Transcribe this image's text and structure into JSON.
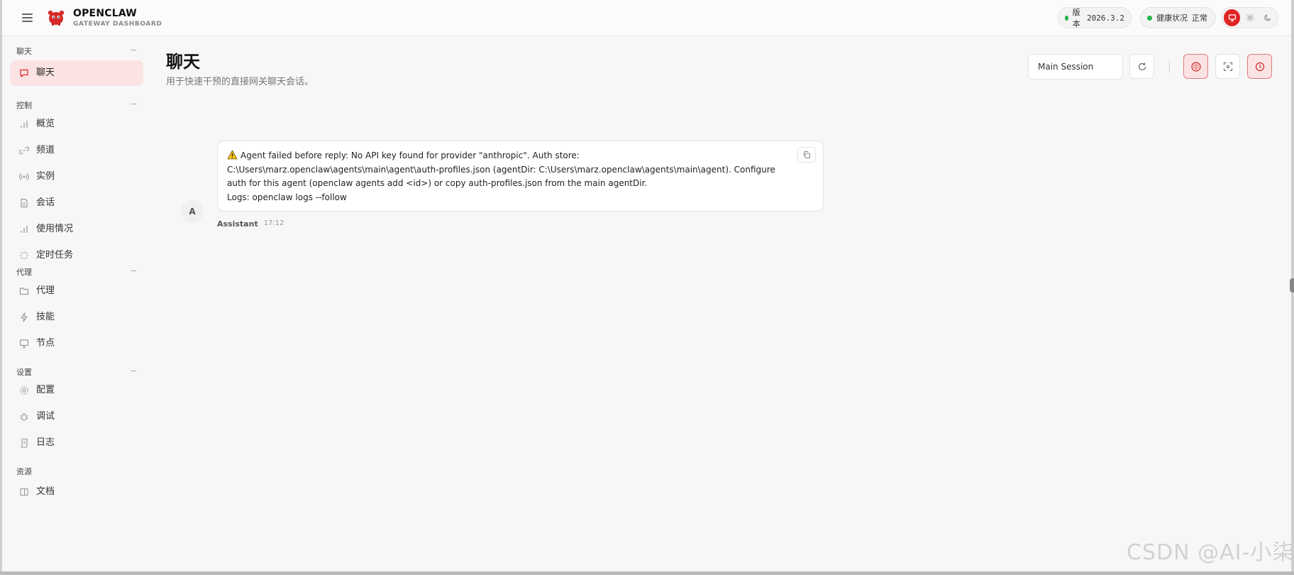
{
  "header": {
    "brand_title": "OPENCLAW",
    "brand_subtitle": "GATEWAY DASHBOARD",
    "version_label": "版本",
    "version_value": "2026.3.2",
    "health_label": "健康状况",
    "health_value": "正常",
    "status_color": "#22b34b",
    "accent_color": "#e02424"
  },
  "sidebar": {
    "groups": [
      {
        "label": "聊天",
        "collapse": "−",
        "items": [
          {
            "label": "聊天",
            "icon": "chat-bubble-icon",
            "active": true
          }
        ]
      },
      {
        "label": "控制",
        "collapse": "−",
        "items": [
          {
            "label": "概览",
            "icon": "bar-chart-icon"
          },
          {
            "label": "频道",
            "icon": "link-icon"
          },
          {
            "label": "实例",
            "icon": "broadcast-icon"
          },
          {
            "label": "会话",
            "icon": "document-icon"
          },
          {
            "label": "使用情况",
            "icon": "bar-chart-icon"
          },
          {
            "label": "定时任务",
            "icon": "loader-icon"
          }
        ]
      },
      {
        "label": "代理",
        "collapse": "−",
        "items": [
          {
            "label": "代理",
            "icon": "folder-icon"
          },
          {
            "label": "技能",
            "icon": "lightning-icon"
          },
          {
            "label": "节点",
            "icon": "monitor-icon"
          }
        ]
      },
      {
        "label": "设置",
        "collapse": "−",
        "items": [
          {
            "label": "配置",
            "icon": "gear-icon"
          },
          {
            "label": "调试",
            "icon": "bug-icon"
          },
          {
            "label": "日志",
            "icon": "scroll-icon"
          }
        ]
      },
      {
        "label": "资源",
        "collapse": "",
        "items": [
          {
            "label": "文档",
            "icon": "book-icon"
          }
        ]
      }
    ]
  },
  "main": {
    "title": "聊天",
    "subtitle": "用于快速干预的直接网关聊天会话。",
    "session_select": "Main Session",
    "message": {
      "avatar_letter": "A",
      "text": "Agent failed before reply: No API key found for provider \"anthropic\". Auth store: C:\\Users\\marz.openclaw\\agents\\main\\agent\\auth-profiles.json (agentDir: C:\\Users\\marz.openclaw\\agents\\main\\agent). Configure auth for this agent (openclaw agents add <id>) or copy auth-profiles.json from the main agentDir.",
      "log_line": "Logs: openclaw logs --follow",
      "sender": "Assistant",
      "time": "17:12"
    }
  },
  "watermark": "CSDN @AI-小柒"
}
